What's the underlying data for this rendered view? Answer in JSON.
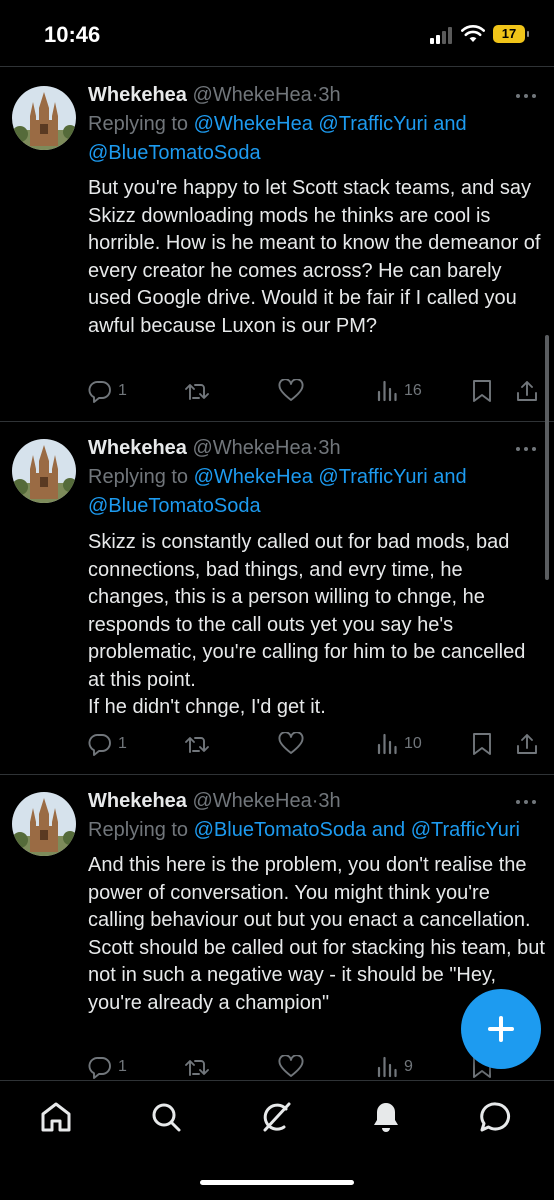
{
  "status_bar": {
    "time": "10:46",
    "battery": "17"
  },
  "tweets": [
    {
      "name": "Whekehea",
      "handle": "@WhekeHea",
      "dot": "·",
      "time": "3h",
      "reply_prefix": "Replying to ",
      "reply_link1": "@WhekeHea @TrafficYuri and",
      "reply_link2": "@BlueTomatoSoda",
      "text": "But you're happy to let Scott stack teams, and say Skizz downloading mods he thinks are cool is horrible. How is he meant to know the demeanor of every creator he comes across? He can barely used Google drive. Would it be fair if I called you awful because Luxon is our PM?",
      "replies": "1",
      "views": "16"
    },
    {
      "name": "Whekehea",
      "handle": "@WhekeHea",
      "dot": "·",
      "time": "3h",
      "reply_prefix": "Replying to ",
      "reply_link1": "@WhekeHea @TrafficYuri and",
      "reply_link2": "@BlueTomatoSoda",
      "text": "Skizz is constantly called out for bad mods, bad connections, bad things, and evry time, he changes, this is a person willing to chnge, he responds to the call outs yet you say he's problematic, you're calling for him to be cancelled at this point.\nIf he didn't chnge, I'd get it.",
      "replies": "1",
      "views": "10"
    },
    {
      "name": "Whekehea",
      "handle": "@WhekeHea",
      "dot": "·",
      "time": "3h",
      "reply_prefix": "Replying to ",
      "reply_link1": "@BlueTomatoSoda and @TrafficYuri",
      "text": "And this here is the problem, you don't realise the power of conversation. You might think you're calling behaviour out but you enact a cancellation.\nScott should be called out for stacking his team, but not in such a negative way - it should be \"Hey, you're already a champion\"",
      "replies": "1",
      "views": "9"
    }
  ],
  "icons": {
    "reply": "reply-icon",
    "retweet": "retweet-icon",
    "like": "like-icon",
    "views": "views-icon",
    "bookmark": "bookmark-icon",
    "share": "share-icon",
    "compose": "compose-plus-icon",
    "home": "home-icon",
    "search": "search-icon",
    "grok": "grok-icon",
    "notifications": "bell-icon",
    "messages": "messages-icon"
  },
  "colors": {
    "accent": "#1d9bf0",
    "background": "#000000",
    "muted": "#71767b",
    "text": "#e7e9ea",
    "battery": "#f0c419"
  }
}
